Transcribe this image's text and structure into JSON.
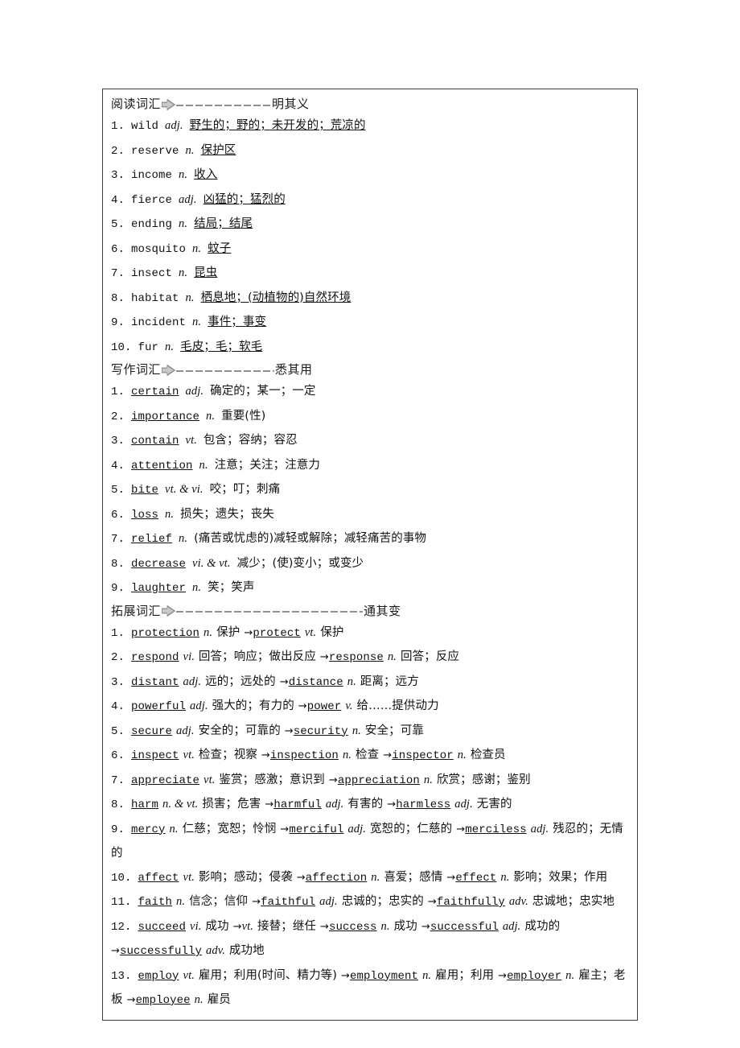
{
  "document": {
    "title": "English Vocabulary Review Sheet",
    "background_color": "#ffffff",
    "border_color": "#3a3a3a"
  },
  "sections": [
    {
      "id": "reading",
      "head_label": "阅读词汇",
      "head_icon": "right-arrow-icon",
      "head_tail": "明其义",
      "dash_width": "short",
      "entries": [
        {
          "num": "1.",
          "word": "wild",
          "word_underlined": false,
          "pos": "adj.",
          "meaning": "野生的；野的；未开发的；荒凉的",
          "meaning_underlined": true
        },
        {
          "num": "2.",
          "word": "reserve",
          "word_underlined": false,
          "pos": "n.",
          "meaning": "保护区",
          "meaning_underlined": true
        },
        {
          "num": "3.",
          "word": "income",
          "word_underlined": false,
          "pos": "n.",
          "meaning": "收入",
          "meaning_underlined": true
        },
        {
          "num": "4.",
          "word": "fierce",
          "word_underlined": false,
          "pos": "adj.",
          "meaning": "凶猛的；猛烈的",
          "meaning_underlined": true
        },
        {
          "num": "5.",
          "word": "ending",
          "word_underlined": false,
          "pos": "n.",
          "meaning": "结局；结尾",
          "meaning_underlined": true
        },
        {
          "num": "6.",
          "word": "mosquito",
          "word_underlined": false,
          "pos": "n.",
          "meaning": "蚊子",
          "meaning_underlined": true
        },
        {
          "num": "7.",
          "word": "insect",
          "word_underlined": false,
          "pos": "n.",
          "meaning": "昆虫",
          "meaning_underlined": true
        },
        {
          "num": "8.",
          "word": "habitat",
          "word_underlined": false,
          "pos": "n.",
          "meaning": "栖息地；(动植物的)自然环境",
          "meaning_underlined": true
        },
        {
          "num": "9.",
          "word": "incident",
          "word_underlined": false,
          "pos": "n.",
          "meaning": "事件；事变",
          "meaning_underlined": true
        },
        {
          "num": "10.",
          "word": "fur",
          "word_underlined": false,
          "pos": "n.",
          "meaning": "毛皮；毛；软毛",
          "meaning_underlined": true
        }
      ]
    },
    {
      "id": "writing",
      "head_label": "写作词汇",
      "head_icon": "right-arrow-icon",
      "head_tail": "悉其用",
      "dash_width": "mid",
      "entries": [
        {
          "num": "1.",
          "word": "certain",
          "word_underlined": true,
          "pos": "adj.",
          "meaning": "确定的；某一；一定",
          "meaning_underlined": false
        },
        {
          "num": "2.",
          "word": "importance",
          "word_underlined": true,
          "pos": "n.",
          "meaning": "重要(性)",
          "meaning_underlined": false
        },
        {
          "num": "3.",
          "word": "contain",
          "word_underlined": true,
          "pos": "vt.",
          "meaning": "包含；容纳；容忍",
          "meaning_underlined": false
        },
        {
          "num": "4.",
          "word": "attention",
          "word_underlined": true,
          "pos": "n.",
          "meaning": "注意；关注；注意力",
          "meaning_underlined": false
        },
        {
          "num": "5.",
          "word": "bite",
          "word_underlined": true,
          "pos": "vt. & vi.",
          "meaning": "咬；叮；刺痛",
          "meaning_underlined": false
        },
        {
          "num": "6.",
          "word": "loss",
          "word_underlined": true,
          "pos": "n.",
          "meaning": "损失；遗失；丧失",
          "meaning_underlined": false
        },
        {
          "num": "7.",
          "word": "relief",
          "word_underlined": true,
          "pos": "n.",
          "meaning": "(痛苦或忧虑的)减轻或解除；减轻痛苦的事物",
          "meaning_underlined": false
        },
        {
          "num": "8.",
          "word": "decrease",
          "word_underlined": true,
          "pos": "vi. & vt.",
          "meaning": "减少；(使)变小；或变少",
          "meaning_underlined": false
        },
        {
          "num": "9.",
          "word": "laughter",
          "word_underlined": true,
          "pos": "n.",
          "meaning": "笑；笑声",
          "meaning_underlined": false
        }
      ]
    },
    {
      "id": "extension",
      "head_label": "拓展词汇",
      "head_icon": "right-arrow-icon",
      "head_tail": "通其变",
      "dash_width": "long",
      "entries": [
        {
          "num": "1.",
          "parts": [
            {
              "w": "protection",
              "p": "n.",
              "m": "保护"
            },
            {
              "w": "protect",
              "p": "vt.",
              "m": "保护"
            }
          ]
        },
        {
          "num": "2.",
          "parts": [
            {
              "w": "respond",
              "p": "vi.",
              "m": "回答；响应；做出反应"
            },
            {
              "w": "response",
              "p": "n.",
              "m": "回答；反应"
            }
          ]
        },
        {
          "num": "3.",
          "parts": [
            {
              "w": "distant",
              "p": "adj.",
              "m": "远的；远处的"
            },
            {
              "w": "distance",
              "p": "n.",
              "m": "距离；远方"
            }
          ]
        },
        {
          "num": "4.",
          "parts": [
            {
              "w": "powerful",
              "p": "adj.",
              "m": "强大的；有力的"
            },
            {
              "w": "power",
              "p": "v.",
              "m": "给……提供动力"
            }
          ]
        },
        {
          "num": "5.",
          "parts": [
            {
              "w": "secure",
              "p": "adj.",
              "m": "安全的；可靠的"
            },
            {
              "w": "security",
              "p": "n.",
              "m": "安全；可靠"
            }
          ]
        },
        {
          "num": "6.",
          "parts": [
            {
              "w": "inspect",
              "p": "vt.",
              "m": "检查；视察"
            },
            {
              "w": "inspection",
              "p": "n.",
              "m": "检查"
            },
            {
              "w": "inspector",
              "p": "n.",
              "m": "检查员"
            }
          ]
        },
        {
          "num": "7.",
          "parts": [
            {
              "w": "appreciate",
              "p": "vt.",
              "m": "鉴赏；感激；意识到"
            },
            {
              "w": "appreciation",
              "p": "n.",
              "m": "欣赏；感谢；鉴别"
            }
          ]
        },
        {
          "num": "8.",
          "parts": [
            {
              "w": "harm",
              "p": "n. & vt.",
              "m": "损害；危害"
            },
            {
              "w": "harmful",
              "p": "adj.",
              "m": "有害的"
            },
            {
              "w": "harmless",
              "p": "adj.",
              "m": "无害的"
            }
          ]
        },
        {
          "num": "9.",
          "parts": [
            {
              "w": "mercy",
              "p": "n.",
              "m": "仁慈；宽恕；怜悯"
            },
            {
              "w": "merciful",
              "p": "adj.",
              "m": "宽恕的；仁慈的"
            },
            {
              "w": "merciless",
              "p": "adj.",
              "m": "残忍的；无情的"
            }
          ]
        },
        {
          "num": "10.",
          "parts": [
            {
              "w": "affect",
              "p": "vt.",
              "m": "影响；感动；侵袭"
            },
            {
              "w": "affection",
              "p": "n.",
              "m": "喜爱；感情"
            },
            {
              "w": "effect",
              "p": "n.",
              "m": "影响；效果；作用"
            }
          ]
        },
        {
          "num": "11.",
          "parts": [
            {
              "w": "faith",
              "p": "n.",
              "m": "信念；信仰"
            },
            {
              "w": "faithful",
              "p": "adj.",
              "m": "忠诚的；忠实的"
            },
            {
              "w": "faithfully",
              "p": "adv.",
              "m": "忠诚地；忠实地"
            }
          ]
        },
        {
          "num": "12.",
          "parts": [
            {
              "w": "succeed",
              "p": "vi.",
              "m": "成功"
            },
            {
              "w": "",
              "p": "vt.",
              "m": "接替；继任",
              "nolink": true
            },
            {
              "w": "success",
              "p": "n.",
              "m": "成功"
            },
            {
              "w": "successful",
              "p": "adj.",
              "m": "成功的"
            },
            {
              "w": "successfully",
              "p": "adv.",
              "m": "成功地"
            }
          ]
        },
        {
          "num": "13.",
          "parts": [
            {
              "w": "employ",
              "p": "vt.",
              "m": "雇用；利用(时间、精力等)"
            },
            {
              "w": "employment",
              "p": "n.",
              "m": "雇用；利用"
            },
            {
              "w": "employer",
              "p": "n.",
              "m": "雇主；老板"
            },
            {
              "w": "employee",
              "p": "n.",
              "m": "雇员"
            }
          ]
        }
      ]
    }
  ],
  "symbols": {
    "arrow_link": "→",
    "amp": "&"
  }
}
